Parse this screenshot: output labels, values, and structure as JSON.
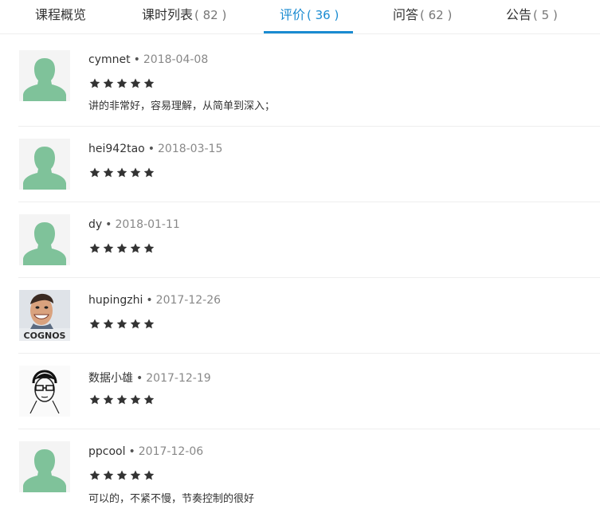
{
  "tabs": [
    {
      "label": "课程概览",
      "count": ""
    },
    {
      "label": "课时列表",
      "count": "( 82 )"
    },
    {
      "label": "评价",
      "count": "( 36 )"
    },
    {
      "label": "问答",
      "count": "( 62 )"
    },
    {
      "label": "公告",
      "count": "( 5 )"
    }
  ],
  "active_tab": "评价",
  "accent_color": "#1a8bd1",
  "star_color": "#333333",
  "reviews": [
    {
      "user": "cymnet",
      "date": "2018-04-08",
      "rating": 5,
      "comment": "讲的非常好，容易理解，从简单到深入；",
      "avatar": "default-avatar-icon"
    },
    {
      "user": "hei942tao",
      "date": "2018-03-15",
      "rating": 5,
      "comment": "",
      "avatar": "default-avatar-icon"
    },
    {
      "user": "dy",
      "date": "2018-01-11",
      "rating": 5,
      "comment": "",
      "avatar": "default-avatar-icon"
    },
    {
      "user": "hupingzhi",
      "date": "2017-12-26",
      "rating": 5,
      "comment": "",
      "avatar": "photo-avatar",
      "avatar_caption": "COGNOS"
    },
    {
      "user": "数据小雄",
      "date": "2017-12-19",
      "rating": 5,
      "comment": "",
      "avatar": "sketch-avatar"
    },
    {
      "user": "ppcool",
      "date": "2017-12-06",
      "rating": 5,
      "comment": "可以的，不紧不慢，节奏控制的很好",
      "avatar": "default-avatar-icon"
    }
  ]
}
